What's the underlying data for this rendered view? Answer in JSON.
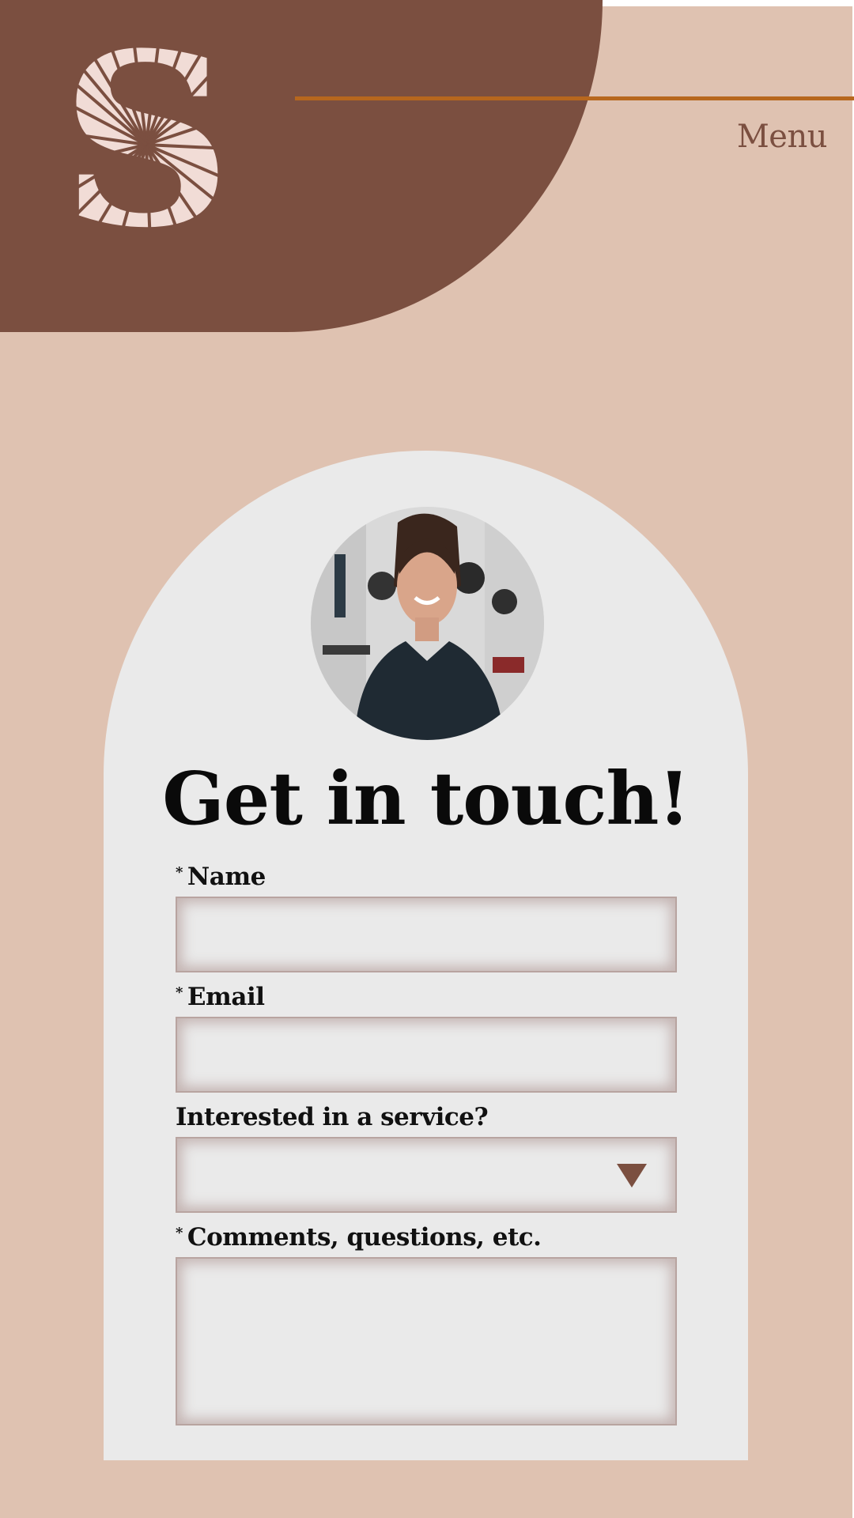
{
  "header": {
    "logo_name": "s-logo-mark",
    "menu_label": "Menu"
  },
  "contact": {
    "title": "Get in touch!",
    "fields": {
      "name": {
        "label": "Name",
        "required_mark": "*",
        "value": ""
      },
      "email": {
        "label": "Email",
        "required_mark": "*",
        "value": ""
      },
      "service": {
        "label": "Interested in a service?",
        "selected": ""
      },
      "comments": {
        "label": "Comments, questions, etc.",
        "required_mark": "*",
        "value": ""
      }
    }
  },
  "colors": {
    "background": "#dfc2b1",
    "brown": "#7b4f40",
    "accent_line": "#b7671e",
    "card": "#eaeaea"
  }
}
